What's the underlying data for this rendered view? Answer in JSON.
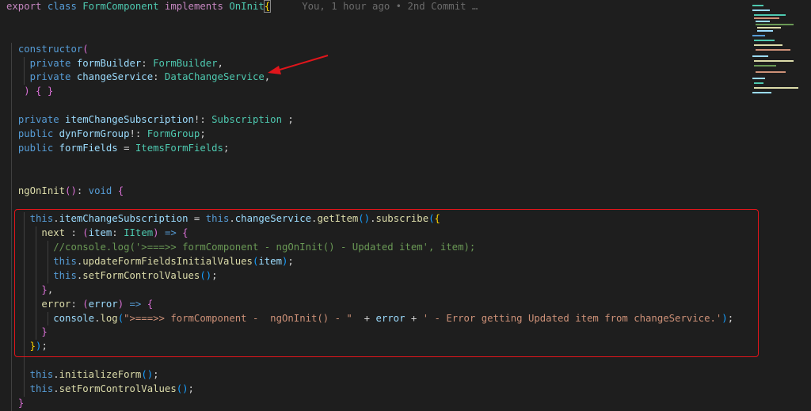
{
  "editor": {
    "blame": "You, 1 hour ago • 2nd Commit …",
    "lines": [
      "export class FormComponent implements OnInit{",
      "constructor(",
      "  private formBuilder: FormBuilder,",
      "  private changeService: DataChangeService,",
      " ) { }",
      "private itemChangeSubscription!: Subscription ;",
      "public dynFormGroup!: FormGroup;",
      "public formFields = ItemsFormFields;",
      "ngOnInit(): void {",
      "  this.itemChangeSubscription = this.changeService.getItem().subscribe({",
      "    next : (item: IItem) => {",
      "      //console.log('>===>> formComponent - ngOnInit() - Updated item', item);",
      "      this.updateFormFieldsInitialValues(item);",
      "      this.setFormControlValues();",
      "    },",
      "    error: (error) => {",
      "      console.log(\">===>> formComponent -  ngOnInit() - \"  + error + ' - Error getting Updated item from changeService.');",
      "    }",
      "  });",
      "  this.initializeForm();",
      "  this.setFormControlValues();",
      "}"
    ]
  },
  "colors": {
    "background": "#1e1e1e",
    "keyword": "#569cd6",
    "type": "#4ec9b0",
    "function": "#dcdcaa",
    "string": "#ce9178",
    "comment": "#6a9955",
    "annotation": "#e0151b"
  },
  "annotations": {
    "arrow": "red-arrow-icon",
    "box": "red-highlight-box"
  }
}
